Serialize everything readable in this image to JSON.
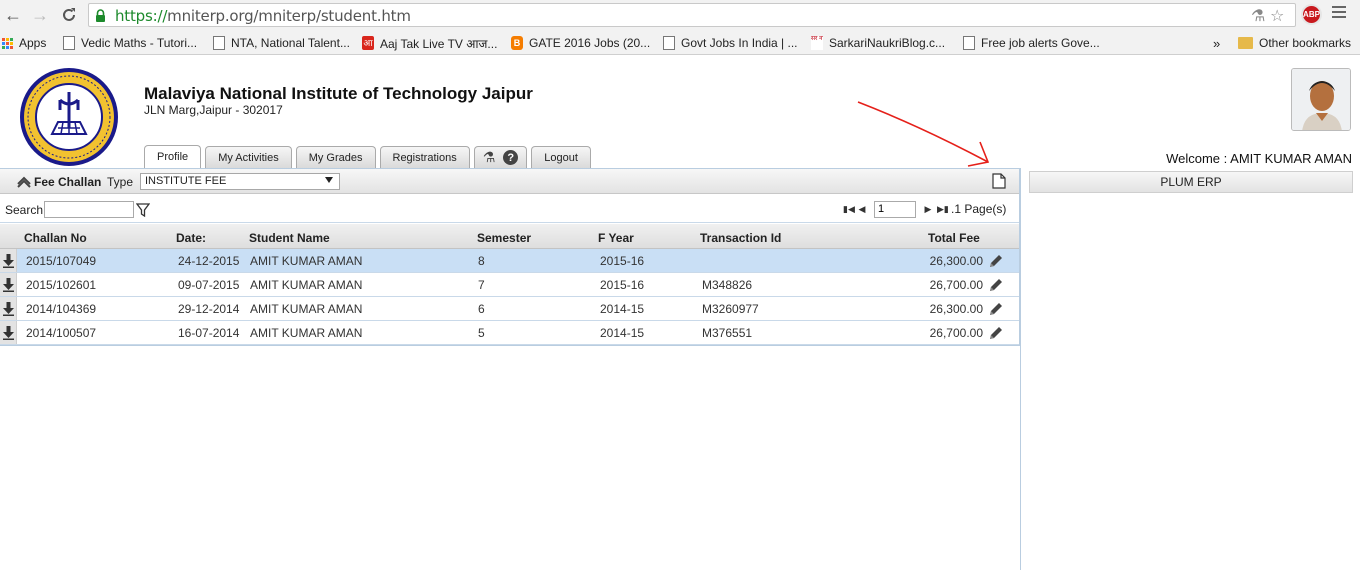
{
  "browser": {
    "url_scheme": "https://",
    "url_rest": "mniterp.org/mniterp/student.htm",
    "adblock_badge": "ABP",
    "bookmarks": [
      {
        "label": "Apps",
        "icon": "apps-grid-icon"
      },
      {
        "label": "Vedic Maths - Tutori...",
        "icon": "page-icon"
      },
      {
        "label": "NTA, National Talent...",
        "icon": "page-icon"
      },
      {
        "label": "Aaj Tak Live TV आज...",
        "icon": "aajtak-icon"
      },
      {
        "label": "GATE 2016 Jobs (20...",
        "icon": "blogger-icon"
      },
      {
        "label": "Govt Jobs In India | ...",
        "icon": "page-icon"
      },
      {
        "label": "SarkariNaukriBlog.c...",
        "icon": "sarkari-icon"
      },
      {
        "label": "Free job alerts Gove...",
        "icon": "page-icon"
      }
    ],
    "overflow": "»",
    "other_bookmarks": "Other bookmarks"
  },
  "header": {
    "institute_name": "Malaviya National Institute of Technology Jaipur",
    "address": "JLN Marg,Jaipur - 302017",
    "welcome": "Welcome : AMIT KUMAR AMAN"
  },
  "tabs": [
    {
      "label": "Profile",
      "active": true
    },
    {
      "label": "My Activities"
    },
    {
      "label": "My Grades"
    },
    {
      "label": "Registrations"
    },
    {
      "label": "Logout"
    }
  ],
  "fee_panel": {
    "title": "Fee Challan",
    "type_label": "Type",
    "type_value": "INSTITUTE FEE",
    "search_label": "Search",
    "search_value": "",
    "page_value": "1",
    "page_suffix": ".1 Page(s)"
  },
  "table": {
    "columns": [
      "Challan No",
      "Date:",
      "Student Name",
      "Semester",
      "F Year",
      "Transaction Id",
      "Total Fee"
    ],
    "rows": [
      {
        "challan": "2015/107049",
        "date": "24-12-2015",
        "name": "AMIT KUMAR AMAN",
        "semester": "8",
        "fyear": "2015-16",
        "txn": "",
        "fee": "26,300.00",
        "selected": true
      },
      {
        "challan": "2015/102601",
        "date": "09-07-2015",
        "name": "AMIT KUMAR AMAN",
        "semester": "7",
        "fyear": "2015-16",
        "txn": "M348826",
        "fee": "26,700.00"
      },
      {
        "challan": "2014/104369",
        "date": "29-12-2014",
        "name": "AMIT KUMAR AMAN",
        "semester": "6",
        "fyear": "2014-15",
        "txn": "M3260977",
        "fee": "26,300.00"
      },
      {
        "challan": "2014/100507",
        "date": "16-07-2014",
        "name": "AMIT KUMAR AMAN",
        "semester": "5",
        "fyear": "2014-15",
        "txn": "M376551",
        "fee": "26,700.00"
      }
    ]
  },
  "right_panel": {
    "title": "PLUM ERP"
  },
  "colors": {
    "accent_border": "#b9cde0",
    "selected_row": "#c9dff5",
    "annotation_arrow": "#e5201a",
    "secure_url": "#1d8a2c"
  }
}
